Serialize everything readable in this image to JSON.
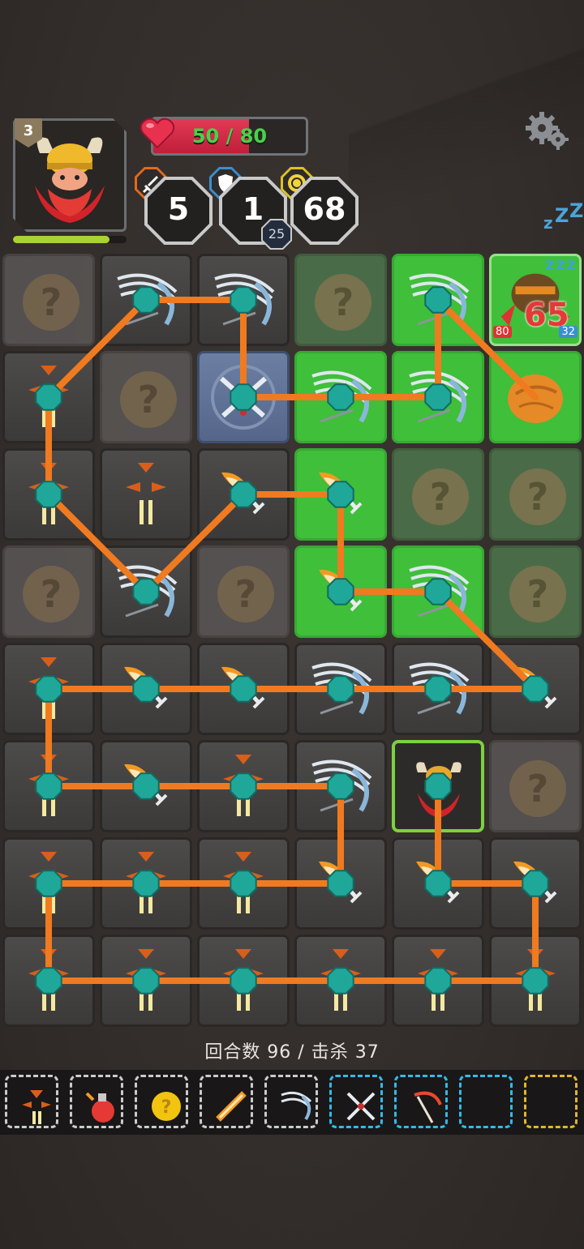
{
  "player": {
    "level": "3",
    "hp_current": "50",
    "hp_max": "80",
    "hp_text": "50 / 80",
    "hp_fraction": 0.625,
    "xp_fraction": 0.85,
    "attack": "5",
    "defense": "1",
    "defense_sub": "25",
    "coins": "68"
  },
  "enemy": {
    "hp": "65",
    "attack": "80",
    "defense": "32",
    "status": "Z Z Z"
  },
  "status_text": "回合数 96 / 击杀 37",
  "colors": {
    "link": "#f07a20",
    "node": "#1fa89a",
    "green_tile": "#3fbf3a",
    "hp_fill": "#d42a47",
    "hp_text": "#48d14a",
    "xp": "#a9d233"
  },
  "board": {
    "rows": [
      [
        "unknown",
        "wind",
        "wind",
        "green-unknown",
        "green-wind",
        "green-enemy"
      ],
      [
        "fire-arrow",
        "unknown",
        "blue-swords",
        "green-wind",
        "green-wind",
        "green-rock"
      ],
      [
        "fire-arrow",
        "fire-arrow",
        "fire-sword",
        "green-fire-sword",
        "green-unknown",
        "green-unknown"
      ],
      [
        "unknown",
        "wind",
        "unknown",
        "green-fire-sword",
        "green-wind",
        "green-unknown"
      ],
      [
        "fire-arrow",
        "fire-sword",
        "fire-sword",
        "wind",
        "wind",
        "fire-sword"
      ],
      [
        "fire-arrow",
        "fire-sword",
        "fire-arrow",
        "wind",
        "hero",
        "unknown"
      ],
      [
        "fire-arrow",
        "fire-arrow",
        "fire-arrow",
        "fire-sword",
        "fire-sword",
        "fire-sword"
      ],
      [
        "fire-arrow",
        "fire-arrow",
        "fire-arrow",
        "fire-arrow",
        "fire-arrow",
        "fire-arrow"
      ]
    ]
  },
  "inventory": [
    {
      "icon": "arrow-icon",
      "style": "gray"
    },
    {
      "icon": "potion-icon",
      "style": "gray"
    },
    {
      "icon": "coin-icon",
      "style": "gray"
    },
    {
      "icon": "fire-sword-icon",
      "style": "gray"
    },
    {
      "icon": "wind-icon",
      "style": "gray"
    },
    {
      "icon": "crossed-swords-icon",
      "style": "blue"
    },
    {
      "icon": "scythe-icon",
      "style": "blue"
    },
    {
      "icon": "empty",
      "style": "blue"
    },
    {
      "icon": "empty",
      "style": "gold"
    }
  ]
}
